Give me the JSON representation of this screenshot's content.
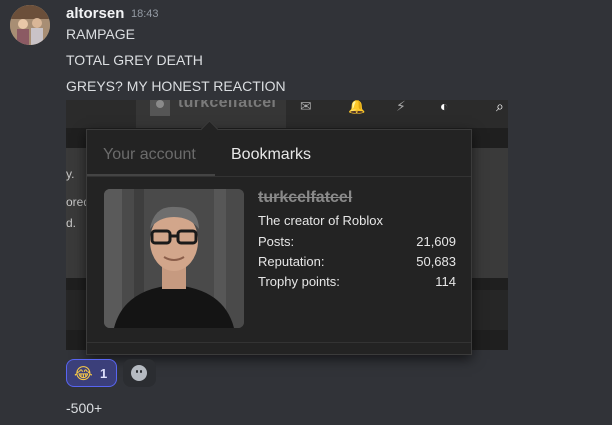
{
  "message": {
    "author": "altorsen",
    "time": "18:43",
    "lines": [
      "RAMPAGE",
      "TOTAL GREY DEATH",
      "GREYS? MY HONEST REACTION"
    ],
    "followup": "-500+"
  },
  "embed": {
    "nav_username": "turkcelfatcel",
    "bg_texts": [
      "y.",
      "ored",
      "d."
    ],
    "popup": {
      "tabs": [
        "Your account",
        "Bookmarks"
      ],
      "username": "turkcelfatcel",
      "title": "The creator of Roblox",
      "stats": [
        {
          "label": "Posts:",
          "value": "21,609"
        },
        {
          "label": "Reputation:",
          "value": "50,683"
        },
        {
          "label": "Trophy points:",
          "value": "114"
        }
      ]
    }
  },
  "reactions": [
    {
      "emoji_name": "joy-emoji",
      "emoji": "😂",
      "count": "1"
    }
  ],
  "colors": {
    "discord_bg": "#313338",
    "reaction_border": "#5865f2",
    "popup_bg": "#232323"
  }
}
